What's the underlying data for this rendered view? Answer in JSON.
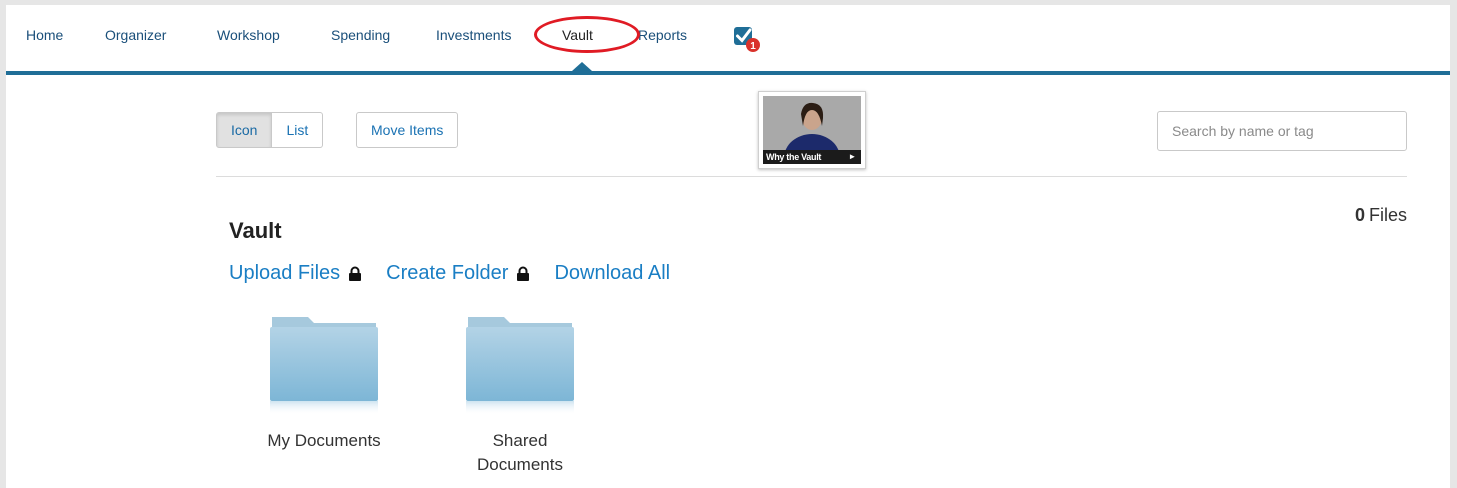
{
  "nav": {
    "items": [
      {
        "label": "Home"
      },
      {
        "label": "Organizer"
      },
      {
        "label": "Workshop"
      },
      {
        "label": "Spending"
      },
      {
        "label": "Investments"
      },
      {
        "label": "Vault"
      },
      {
        "label": "Reports"
      }
    ],
    "active": "Vault",
    "todo_badge_count": "1",
    "accent_color": "#1f6e97",
    "highlight_color": "#e01b24"
  },
  "toolbar": {
    "view_icon_label": "Icon",
    "view_list_label": "List",
    "move_items_label": "Move Items",
    "video_caption": "Why the Vault",
    "search_placeholder": "Search by name or tag"
  },
  "vault": {
    "title": "Vault",
    "files_count": "0",
    "files_label": "Files",
    "actions": {
      "upload": "Upload Files",
      "create_folder": "Create Folder",
      "download_all": "Download All"
    },
    "folders": [
      {
        "label_line1": "My Documents",
        "label_line2": ""
      },
      {
        "label_line1": "Shared",
        "label_line2": "Documents"
      }
    ]
  }
}
